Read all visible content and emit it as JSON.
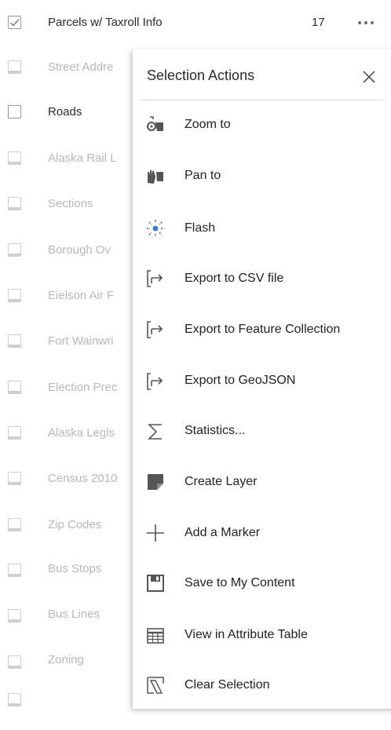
{
  "layers": [
    {
      "label": "Parcels w/ Taxroll Info",
      "count": "17",
      "state": "checked"
    },
    {
      "label": "Street Addre",
      "state": "disabled"
    },
    {
      "label": "Roads",
      "state": "unchecked"
    },
    {
      "label": "Alaska Rail L",
      "state": "disabled"
    },
    {
      "label": "Sections",
      "state": "disabled"
    },
    {
      "label": "Borough Ov",
      "state": "disabled"
    },
    {
      "label": "Eielson Air F",
      "state": "disabled"
    },
    {
      "label": "Fort Wainwri",
      "state": "disabled"
    },
    {
      "label": "Election Prec",
      "state": "disabled"
    },
    {
      "label": "Alaska Legis",
      "state": "disabled"
    },
    {
      "label": "Census 2010",
      "state": "disabled"
    },
    {
      "label": "Zip Codes",
      "state": "disabled"
    },
    {
      "label": "Bus Stops",
      "state": "disabled"
    },
    {
      "label": "Bus Lines",
      "state": "disabled"
    },
    {
      "label": "Zoning",
      "state": "disabled"
    }
  ],
  "popup": {
    "title": "Selection Actions",
    "actions": [
      {
        "label": "Zoom to",
        "icon": "zoom-to-icon"
      },
      {
        "label": "Pan to",
        "icon": "pan-to-icon"
      },
      {
        "label": "Flash",
        "icon": "flash-icon"
      },
      {
        "label": "Export to CSV file",
        "icon": "export-icon"
      },
      {
        "label": "Export to Feature Collection",
        "icon": "export-icon"
      },
      {
        "label": "Export to GeoJSON",
        "icon": "export-icon"
      },
      {
        "label": "Statistics...",
        "icon": "sigma-icon"
      },
      {
        "label": "Create Layer",
        "icon": "create-layer-icon"
      },
      {
        "label": "Add a Marker",
        "icon": "plus-icon"
      },
      {
        "label": "Save to My Content",
        "icon": "save-icon"
      },
      {
        "label": "View in Attribute Table",
        "icon": "table-icon"
      },
      {
        "label": "Clear Selection",
        "icon": "clear-selection-icon"
      }
    ]
  },
  "colors": {
    "text": "#2b2b2b",
    "disabled_text": "#b8b8b8",
    "icon": "#555555",
    "flash": "#3a7fd0"
  }
}
